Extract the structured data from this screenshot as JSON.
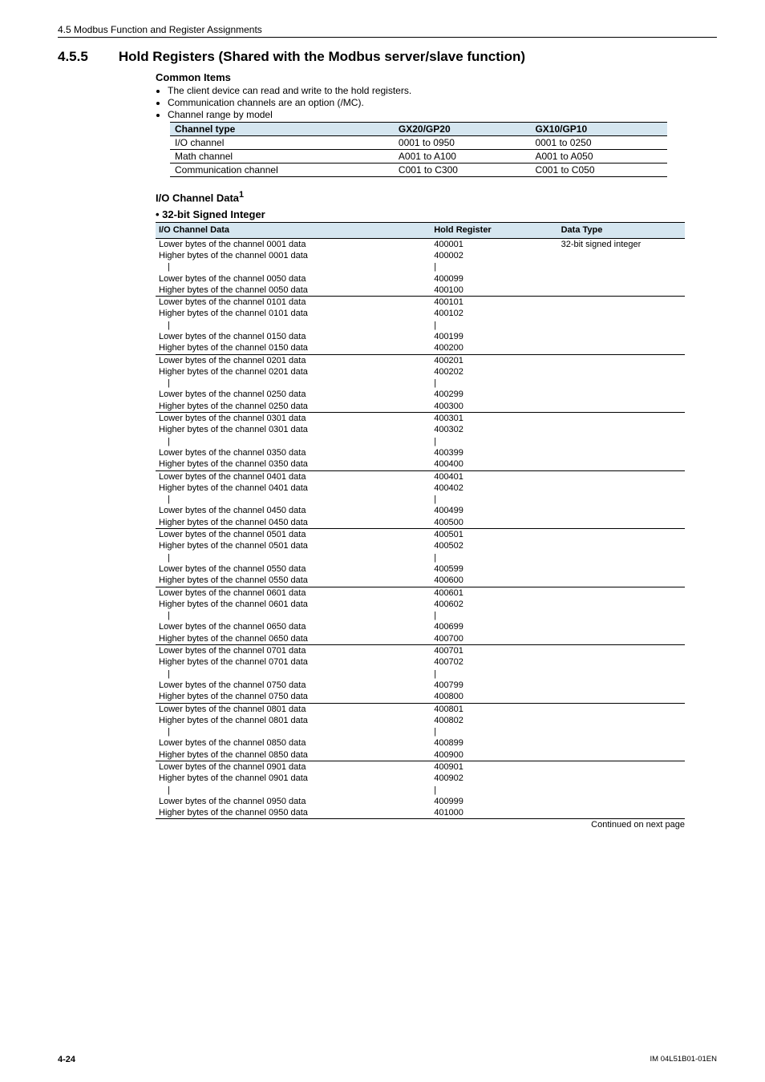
{
  "running_head": "4.5  Modbus Function and Register Assignments",
  "section": {
    "number": "4.5.5",
    "title": "Hold Registers (Shared with the Modbus server/slave function)"
  },
  "common_items": {
    "heading": "Common Items",
    "bullets": [
      "The client device can read and write to the hold registers.",
      "Communication channels are an option (/MC).",
      "Channel range by model"
    ]
  },
  "channel_table": {
    "headers": [
      "Channel type",
      "GX20/GP20",
      "GX10/GP10"
    ],
    "rows": [
      [
        "I/O channel",
        "0001 to 0950",
        "0001 to 0250"
      ],
      [
        "Math channel",
        "A001 to A100",
        "A001 to A050"
      ],
      [
        "Communication channel",
        "C001 to C300",
        "C001 to C050"
      ]
    ]
  },
  "io_section": {
    "heading_html": "I/O Channel Data",
    "heading_sup": "1",
    "sub_heading": "• 32-bit Signed Integer",
    "table_headers": {
      "c1": "I/O Channel Data",
      "c2": "Hold Register",
      "c3": "Data Type"
    },
    "data_type": "32-bit signed integer"
  },
  "chart_data": {
    "type": "table",
    "title": "I/O Channel Data — 32-bit Signed Integer Hold Register map",
    "groups": [
      {
        "low_label": "Lower bytes of the channel 0001 data",
        "low_reg": "400001",
        "high_label": "Higher bytes of the channel 0001 data",
        "high_reg": "400002",
        "end_low_label": "Lower bytes of the channel 0050 data",
        "end_low_reg": "400099",
        "end_high_label": "Higher bytes of the channel 0050 data",
        "end_high_reg": "400100"
      },
      {
        "low_label": "Lower bytes of the channel 0101 data",
        "low_reg": "400101",
        "high_label": "Higher bytes of the channel 0101 data",
        "high_reg": "400102",
        "end_low_label": "Lower bytes of the channel 0150 data",
        "end_low_reg": "400199",
        "end_high_label": "Higher bytes of the channel 0150 data",
        "end_high_reg": "400200"
      },
      {
        "low_label": "Lower bytes of the channel 0201 data",
        "low_reg": "400201",
        "high_label": "Higher bytes of the channel 0201 data",
        "high_reg": "400202",
        "end_low_label": "Lower bytes of the channel 0250 data",
        "end_low_reg": "400299",
        "end_high_label": "Higher bytes of the channel 0250 data",
        "end_high_reg": "400300"
      },
      {
        "low_label": "Lower bytes of the channel 0301 data",
        "low_reg": "400301",
        "high_label": "Higher bytes of the channel 0301 data",
        "high_reg": "400302",
        "end_low_label": "Lower bytes of the channel 0350 data",
        "end_low_reg": "400399",
        "end_high_label": "Higher bytes of the channel 0350 data",
        "end_high_reg": "400400"
      },
      {
        "low_label": "Lower bytes of the channel 0401 data",
        "low_reg": "400401",
        "high_label": "Higher bytes of the channel 0401 data",
        "high_reg": "400402",
        "end_low_label": "Lower bytes of the channel 0450 data",
        "end_low_reg": "400499",
        "end_high_label": "Higher bytes of the channel 0450 data",
        "end_high_reg": "400500"
      },
      {
        "low_label": "Lower bytes of the channel 0501 data",
        "low_reg": "400501",
        "high_label": "Higher bytes of the channel 0501 data",
        "high_reg": "400502",
        "end_low_label": "Lower bytes of the channel 0550 data",
        "end_low_reg": "400599",
        "end_high_label": "Higher bytes of the channel 0550 data",
        "end_high_reg": "400600"
      },
      {
        "low_label": "Lower bytes of the channel 0601 data",
        "low_reg": "400601",
        "high_label": "Higher bytes of the channel 0601 data",
        "high_reg": "400602",
        "end_low_label": "Lower bytes of the channel 0650 data",
        "end_low_reg": "400699",
        "end_high_label": "Higher bytes of the channel 0650 data",
        "end_high_reg": "400700"
      },
      {
        "low_label": "Lower bytes of the channel 0701 data",
        "low_reg": "400701",
        "high_label": "Higher bytes of the channel 0701 data",
        "high_reg": "400702",
        "end_low_label": "Lower bytes of the channel 0750 data",
        "end_low_reg": "400799",
        "end_high_label": "Higher bytes of the channel 0750 data",
        "end_high_reg": "400800"
      },
      {
        "low_label": "Lower bytes of the channel 0801 data",
        "low_reg": "400801",
        "high_label": "Higher bytes of the channel 0801 data",
        "high_reg": "400802",
        "end_low_label": "Lower bytes of the channel 0850 data",
        "end_low_reg": "400899",
        "end_high_label": "Higher bytes of the channel 0850 data",
        "end_high_reg": "400900"
      },
      {
        "low_label": "Lower bytes of the channel 0901 data",
        "low_reg": "400901",
        "high_label": "Higher bytes of the channel 0901 data",
        "high_reg": "400902",
        "end_low_label": "Lower bytes of the channel 0950 data",
        "end_low_reg": "400999",
        "end_high_label": "Higher bytes of the channel 0950 data",
        "end_high_reg": "401000"
      }
    ]
  },
  "continued": "Continued on next page",
  "footer": {
    "page": "4-24",
    "docid": "IM 04L51B01-01EN"
  }
}
